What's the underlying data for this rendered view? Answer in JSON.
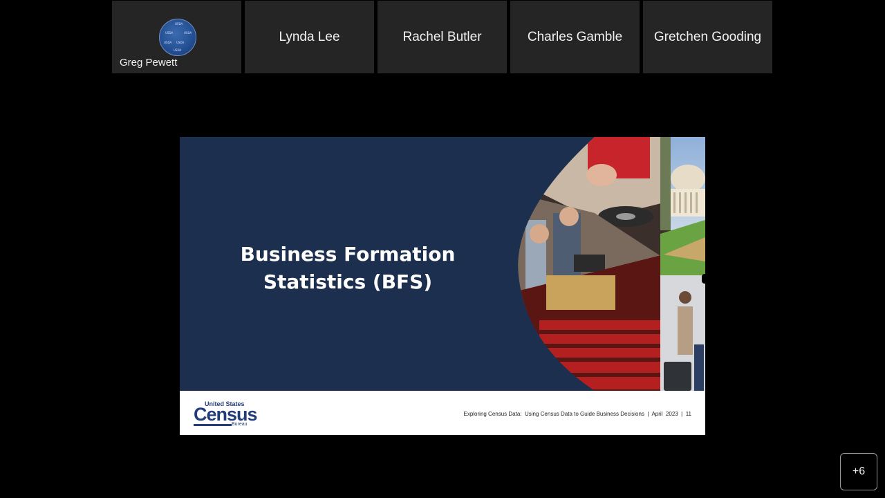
{
  "participants": [
    {
      "name": "Greg Pewett",
      "has_avatar": true
    },
    {
      "name": "Lynda Lee"
    },
    {
      "name": "Rachel Butler"
    },
    {
      "name": "Charles Gamble"
    },
    {
      "name": "Gretchen Gooding"
    }
  ],
  "slide": {
    "title_line1": "Business Formation",
    "title_line2": "Statistics (BFS)",
    "logo": {
      "top": "United States",
      "main": "Census",
      "bottom": "Bureau"
    },
    "footer_text": "Exploring Census Data:  Using Census Data to Guide Business Decisions  |  April  2023  |  11",
    "colors": {
      "background": "#1c2f4f",
      "footer": "#ffffff",
      "logo": "#233c7a"
    }
  },
  "overflow_button": {
    "label": "+6"
  }
}
